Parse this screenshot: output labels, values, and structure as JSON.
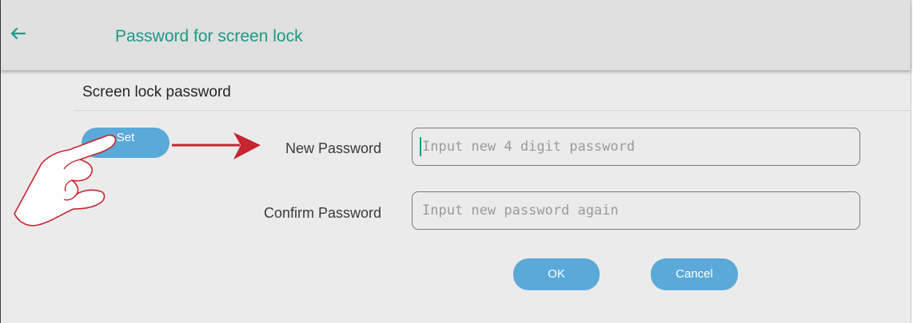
{
  "header": {
    "back_icon": "arrow-left-icon",
    "title": "Password for screen lock"
  },
  "section": {
    "title": "Screen lock password"
  },
  "set_button": {
    "label": "Set"
  },
  "new_password": {
    "label": "New Password",
    "placeholder": "Input new 4 digit password"
  },
  "confirm_password": {
    "label": "Confirm Password",
    "placeholder": "Input new password again"
  },
  "actions": {
    "ok_label": "OK",
    "cancel_label": "Cancel"
  },
  "annotation": {
    "hand_icon": "pointing-hand-icon",
    "arrow_icon": "arrow-right-icon",
    "arrow_color": "#c62530"
  },
  "colors": {
    "accent": "#1a9a86",
    "button": "#5aa9d9"
  }
}
